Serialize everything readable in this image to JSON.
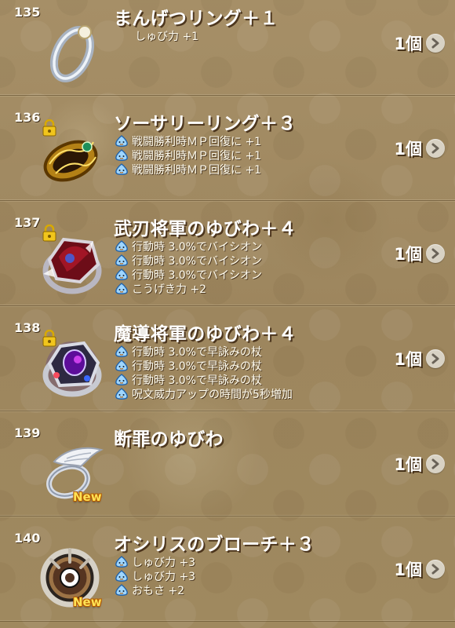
{
  "items": [
    {
      "number": "135",
      "name": "まんげつリング＋１",
      "locked": false,
      "new": false,
      "effects": [
        {
          "icon": "none",
          "text": "しゅび力 +1"
        }
      ],
      "quantity": "1個"
    },
    {
      "number": "136",
      "name": "ソーサリーリング＋３",
      "locked": true,
      "new": false,
      "effects": [
        {
          "icon": "slime-icon",
          "text": "戦闘勝利時ＭＰ回復に +1"
        },
        {
          "icon": "slime-icon",
          "text": "戦闘勝利時ＭＰ回復に +1"
        },
        {
          "icon": "slime-icon",
          "text": "戦闘勝利時ＭＰ回復に +1"
        }
      ],
      "quantity": "1個"
    },
    {
      "number": "137",
      "name": "武刃将軍のゆびわ＋４",
      "locked": true,
      "new": false,
      "effects": [
        {
          "icon": "slime-icon",
          "text": "行動時 3.0%でバイシオン"
        },
        {
          "icon": "slime-icon",
          "text": "行動時 3.0%でバイシオン"
        },
        {
          "icon": "slime-icon",
          "text": "行動時 3.0%でバイシオン"
        },
        {
          "icon": "slime-icon",
          "text": "こうげき力 +2"
        }
      ],
      "quantity": "1個"
    },
    {
      "number": "138",
      "name": "魔導将軍のゆびわ＋４",
      "locked": true,
      "new": false,
      "effects": [
        {
          "icon": "slime-icon",
          "text": "行動時 3.0%で早詠みの杖"
        },
        {
          "icon": "slime-icon",
          "text": "行動時 3.0%で早詠みの杖"
        },
        {
          "icon": "slime-icon",
          "text": "行動時 3.0%で早詠みの杖"
        },
        {
          "icon": "slime-icon",
          "text": "呪文威力アップの時間が5秒増加"
        }
      ],
      "quantity": "1個"
    },
    {
      "number": "139",
      "name": "断罪のゆびわ",
      "locked": false,
      "new": true,
      "effects": [],
      "quantity": "1個"
    },
    {
      "number": "140",
      "name": "オシリスのブローチ＋３",
      "locked": false,
      "new": true,
      "effects": [
        {
          "icon": "slime-icon",
          "text": "しゅび力 +3"
        },
        {
          "icon": "slime-icon",
          "text": "しゅび力 +3"
        },
        {
          "icon": "slime-icon",
          "text": "おもさ +2"
        }
      ],
      "quantity": "1個"
    }
  ],
  "badges": {
    "new": "New"
  },
  "icons": {
    "detail": "chevron-right-icon",
    "lock": "lock-icon",
    "effect": "slime-icon"
  }
}
